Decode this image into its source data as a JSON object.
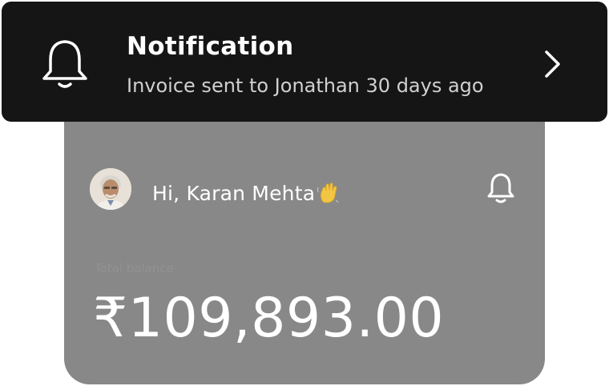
{
  "notification": {
    "title": "Notification",
    "message": "Invoice sent to Jonathan 30 days ago",
    "icon": "bell-icon",
    "action_icon": "chevron-right-icon"
  },
  "home": {
    "greeting": "Hi, Karan Mehta",
    "greeting_emoji": "waving-hand-icon",
    "balance_label": "Total balance",
    "balance_amount": "₹109,893.00",
    "notifications_icon": "bell-icon"
  },
  "colors": {
    "banner_bg": "#151515",
    "card_bg": "#888888",
    "text_primary": "#ffffff",
    "text_secondary": "#d0d0d0"
  }
}
